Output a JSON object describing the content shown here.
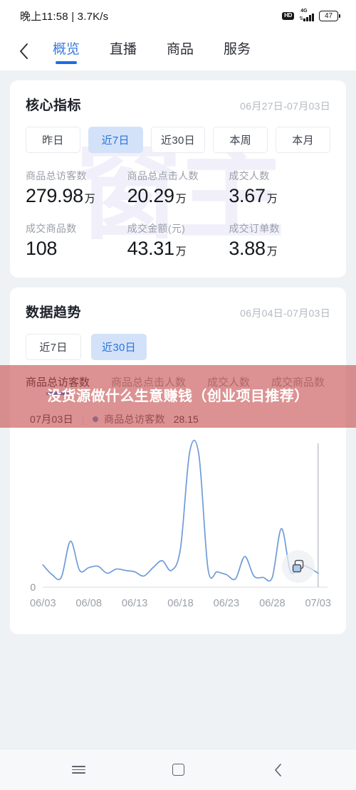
{
  "status_bar": {
    "time_network": "晚上11:58 | 3.7K/s",
    "hd_label": "HD",
    "network_type": "4G",
    "battery_level": "47"
  },
  "topbar": {
    "back_icon": "chevron-left-icon",
    "tabs": [
      {
        "label": "概览",
        "active": true
      },
      {
        "label": "直播",
        "active": false
      },
      {
        "label": "商品",
        "active": false
      },
      {
        "label": "服务",
        "active": false
      }
    ]
  },
  "core_metrics": {
    "title": "核心指标",
    "range": "06月27日-07月03日",
    "watermark": "窗主",
    "chips": [
      {
        "label": "昨日",
        "selected": false
      },
      {
        "label": "近7日",
        "selected": true
      },
      {
        "label": "近30日",
        "selected": false
      },
      {
        "label": "本周",
        "selected": false
      },
      {
        "label": "本月",
        "selected": false
      }
    ],
    "metrics": [
      {
        "label": "商品总访客数",
        "value": "279.98",
        "unit": "万"
      },
      {
        "label": "商品总点击人数",
        "value": "20.29",
        "unit": "万"
      },
      {
        "label": "成交人数",
        "value": "3.67",
        "unit": "万"
      },
      {
        "label": "成交商品数",
        "value": "108",
        "unit": ""
      },
      {
        "label": "成交金额(元)",
        "value": "43.31",
        "unit": "万"
      },
      {
        "label": "成交订单数",
        "value": "3.88",
        "unit": "万"
      }
    ]
  },
  "data_trends": {
    "title": "数据趋势",
    "range": "06月04日-07月03日",
    "chips": [
      {
        "label": "近7日",
        "selected": false
      },
      {
        "label": "近30日",
        "selected": true
      }
    ],
    "metric_tabs": [
      {
        "label": "商品总访客数",
        "active": true
      },
      {
        "label": "商品总点击人数",
        "active": false
      },
      {
        "label": "成交人数",
        "active": false
      },
      {
        "label": "成交商品数",
        "active": false
      }
    ],
    "legend": {
      "date": "07月03日",
      "series_name": "商品总访客数",
      "series_value": "28.15",
      "dot_color": "#5b8fdd"
    },
    "float_button_icon": "copy-duplicate-icon"
  },
  "chart_data": {
    "type": "line",
    "title": "数据趋势",
    "xlabel": "",
    "ylabel": "",
    "grid": false,
    "legend_position": "top-left",
    "line_color": "#6f9cd8",
    "ylim": [
      0,
      100
    ],
    "yticks": [
      "0"
    ],
    "xticks": [
      "06/03",
      "06/08",
      "06/13",
      "06/18",
      "06/23",
      "06/28",
      "07/03"
    ],
    "x": [
      "06/03",
      "06/04",
      "06/05",
      "06/06",
      "06/07",
      "06/08",
      "06/09",
      "06/10",
      "06/11",
      "06/12",
      "06/13",
      "06/14",
      "06/15",
      "06/16",
      "06/17",
      "06/18",
      "06/19",
      "06/20",
      "06/21",
      "06/22",
      "06/23",
      "06/24",
      "06/25",
      "06/26",
      "06/27",
      "06/28",
      "06/29",
      "06/30",
      "07/01",
      "07/02",
      "07/03"
    ],
    "series": [
      {
        "name": "商品总访客数",
        "values": [
          16,
          9,
          7,
          33,
          12,
          14,
          15,
          10,
          13,
          12,
          11,
          8,
          14,
          19,
          12,
          28,
          97,
          95,
          13,
          11,
          9,
          6,
          22,
          8,
          7,
          7,
          42,
          11,
          16,
          14,
          10
        ]
      }
    ],
    "annotations": [
      {
        "type": "vertical-line",
        "x": "07/03",
        "color": "#b6bcc6"
      }
    ]
  },
  "overlay_banner": {
    "text": "没货源做什么生意赚钱（创业项目推荐）",
    "background_color": "#c44a4a"
  },
  "bottom_nav": [
    {
      "icon": "menu-recents-icon",
      "name": "recents"
    },
    {
      "icon": "square-home-icon",
      "name": "home"
    },
    {
      "icon": "chevron-left-back-icon",
      "name": "back"
    }
  ]
}
